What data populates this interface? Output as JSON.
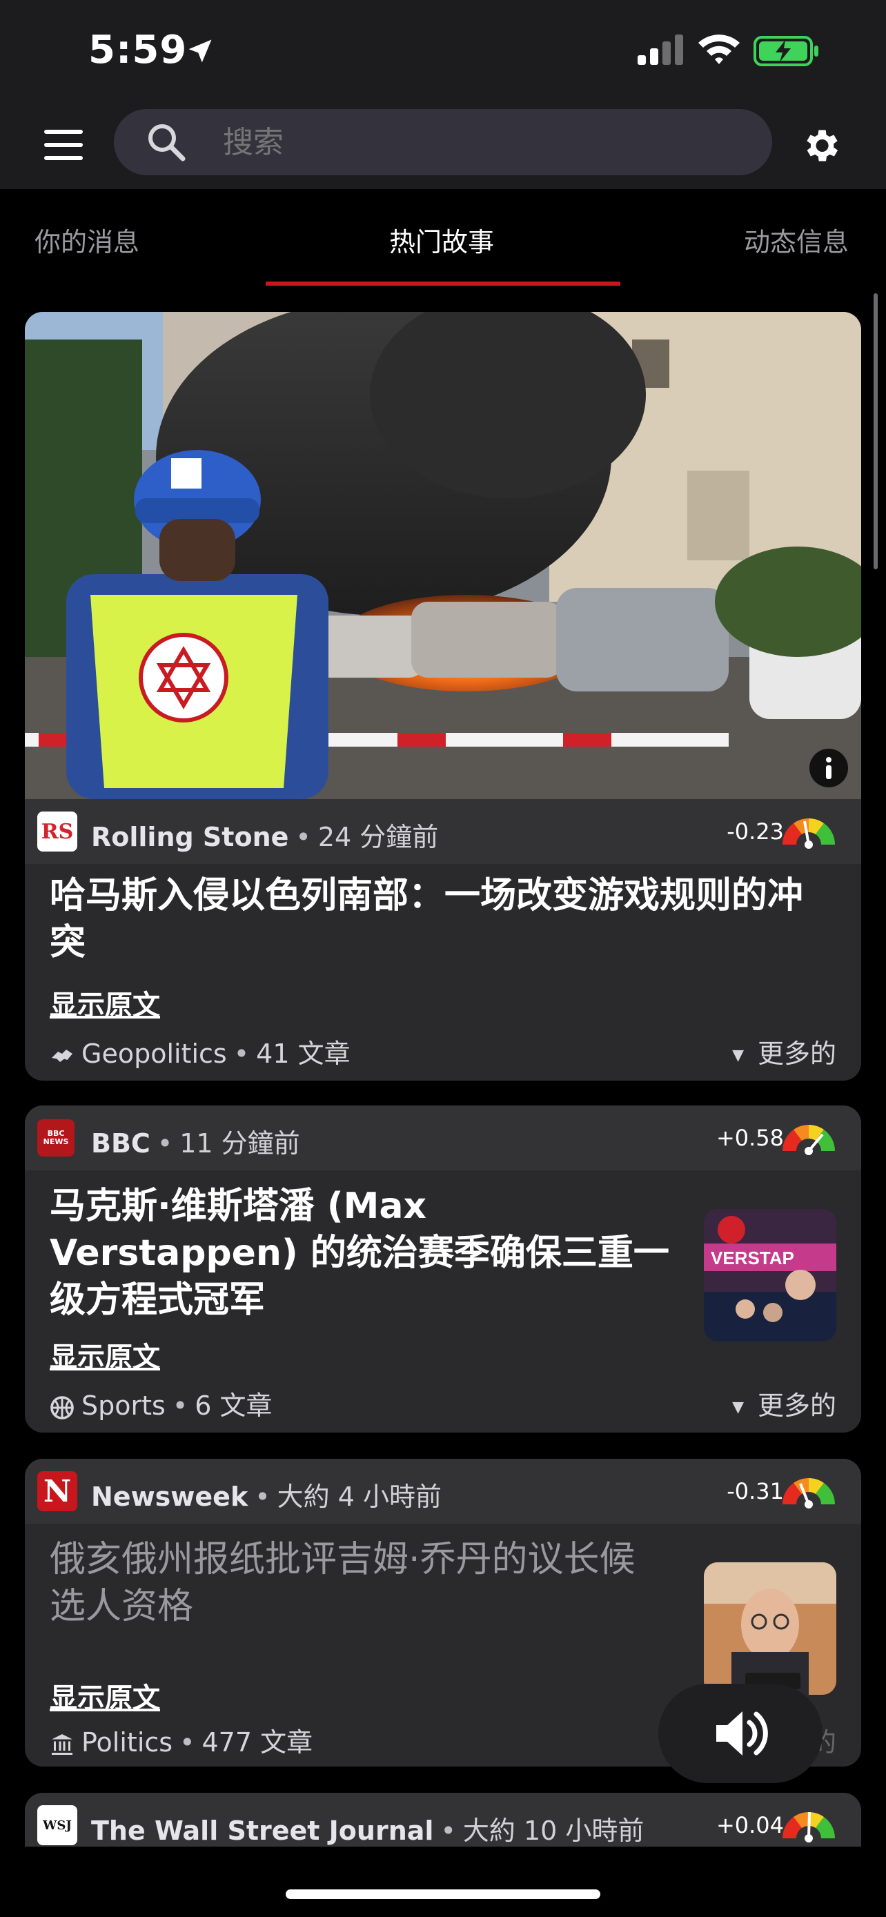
{
  "status_bar": {
    "time": "5:59"
  },
  "search": {
    "placeholder": "搜索"
  },
  "tabs": [
    {
      "label": "你的消息"
    },
    {
      "label": "热门故事",
      "active": true
    },
    {
      "label": "动态信息"
    }
  ],
  "cards": [
    {
      "source": "Rolling Stone",
      "logo_text": "RS",
      "ago": "24 分鐘前",
      "score": "-0.23",
      "headline": "哈马斯入侵以色列南部：一场改变游戏规则的冲突",
      "show_original": "显示原文",
      "category": "Geopolitics",
      "article_count": "41 文章",
      "more": "更多的",
      "image_icon": "info-icon"
    },
    {
      "source": "BBC",
      "logo_text": "BBC NEWS",
      "ago": "11 分鐘前",
      "score": "+0.58",
      "headline": "马克斯·维斯塔潘 (Max Verstappen) 的统治赛季确保三重一级方程式冠军",
      "show_original": "显示原文",
      "category": "Sports",
      "article_count": "6 文章",
      "more": "更多的"
    },
    {
      "source": "Newsweek",
      "logo_text": "N",
      "ago": "大約 4 小時前",
      "score": "-0.31",
      "headline": "俄亥俄州报纸批评吉姆·乔丹的议长候选人资格",
      "show_original": "显示原文",
      "category": "Politics",
      "article_count": "477 文章",
      "more": "更多的"
    },
    {
      "source": "The Wall Street Journal",
      "logo_text": "WSJ",
      "ago": "大約 10 小時前",
      "score": "+0.04"
    }
  ],
  "colors": {
    "accent": "#c8161d",
    "card": "#2a2a2c",
    "card_header": "#333335"
  }
}
